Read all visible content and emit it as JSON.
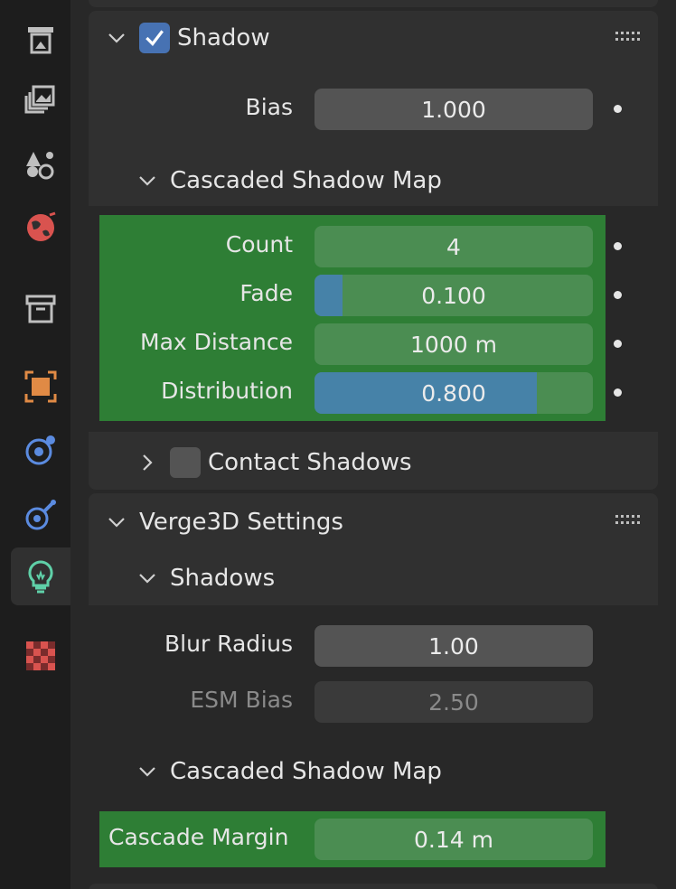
{
  "sidebar": {
    "tabs": [
      {
        "name": "output-properties-icon",
        "color": "#bfbfbf"
      },
      {
        "name": "view-layer-properties-icon",
        "color": "#bfbfbf"
      },
      {
        "name": "scene-properties-icon",
        "color": "#bfbfbf"
      },
      {
        "name": "world-properties-icon",
        "color": "#d9534f"
      },
      {
        "name": "collection-properties-icon",
        "color": "#bfbfbf"
      },
      {
        "name": "object-properties-icon",
        "color": "#e08a45"
      },
      {
        "name": "physics-properties-icon",
        "color": "#5b8be0"
      },
      {
        "name": "constraint-properties-icon",
        "color": "#5b8be0"
      },
      {
        "name": "light-data-properties-icon",
        "color": "#5fd0a8",
        "active": true
      },
      {
        "name": "texture-properties-icon",
        "color": "#d9534f"
      }
    ]
  },
  "shadow_panel": {
    "title": "Shadow",
    "enabled": true,
    "bias_label": "Bias",
    "bias_value": "1.000",
    "csm_title": "Cascaded Shadow Map",
    "csm_fields": [
      {
        "label": "Count",
        "value": "4",
        "fill": 0
      },
      {
        "label": "Fade",
        "value": "0.100",
        "fill": 0.1
      },
      {
        "label": "Max Distance",
        "value": "1000 m",
        "fill": 0
      },
      {
        "label": "Distribution",
        "value": "0.800",
        "fill": 0.8
      }
    ],
    "contact_title": "Contact Shadows",
    "contact_enabled": false
  },
  "verge_panel": {
    "title": "Verge3D Settings",
    "shadows_title": "Shadows",
    "blur_label": "Blur Radius",
    "blur_value": "1.00",
    "esm_label": "ESM Bias",
    "esm_value": "2.50",
    "csm_title": "Cascaded Shadow Map",
    "margin_label": "Cascade Margin",
    "margin_value": "0.14 m"
  },
  "colors": {
    "highlight_green": "#2e7e35",
    "slider_blue": "#4682a8",
    "checkbox_blue": "#4772b3"
  }
}
